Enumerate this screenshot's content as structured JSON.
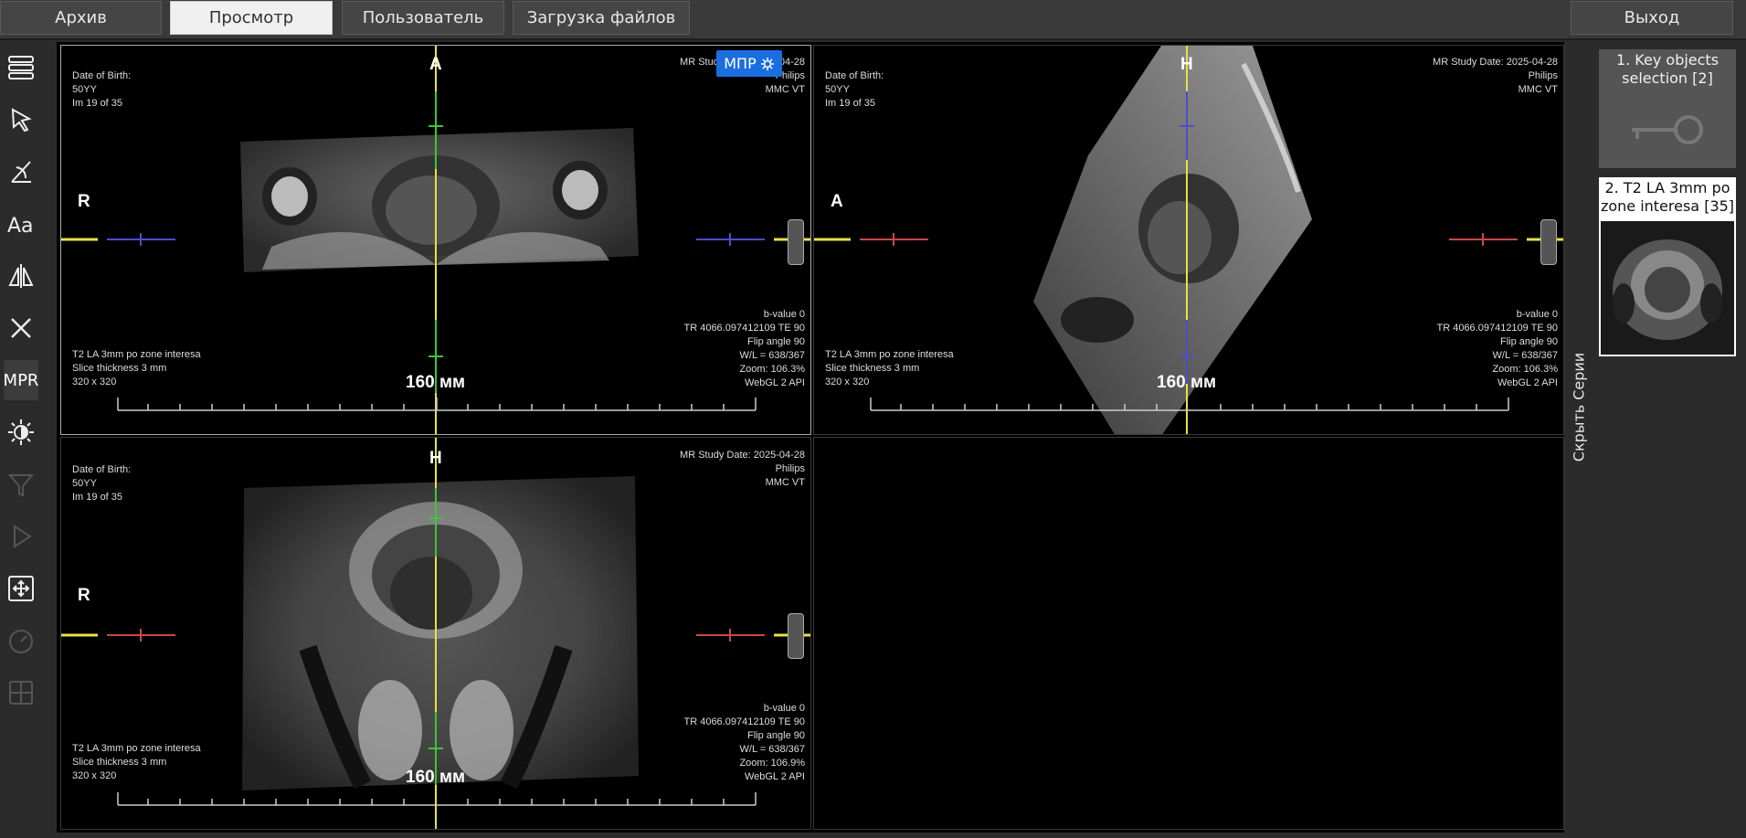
{
  "topbar": {
    "tabs": [
      {
        "label": "Архив"
      },
      {
        "label": "Просмотр"
      },
      {
        "label": "Пользователь"
      },
      {
        "label": "Загрузка файлов"
      }
    ],
    "exit_label": "Выход"
  },
  "toolbar": {
    "mpr_label": "MPR"
  },
  "mpr_badge": {
    "label": "МПР"
  },
  "viewports": [
    {
      "top_left": [
        "Date of Birth:",
        "50YY",
        "Im 19 of 35"
      ],
      "top_right": [
        "MR Study Date: 2025-04-28",
        "Philips",
        "MMC VT"
      ],
      "orient_top": "A",
      "orient_left": "R",
      "bottom_left": [
        "T2 LA 3mm po zone interesa",
        "Slice thickness 3 mm",
        "320 x 320"
      ],
      "bottom_right": [
        "b-value 0",
        "TR 4066.097412109 TE 90",
        "Flip angle 90",
        "W/L = 638/367",
        "Zoom: 106.3%",
        "WebGL 2 API"
      ],
      "scale": "160 мм"
    },
    {
      "top_left": [
        "Date of Birth:",
        "50YY",
        "Im 19 of 35"
      ],
      "top_right": [
        "MR Study Date: 2025-04-28",
        "Philips",
        "MMC VT"
      ],
      "orient_top": "H",
      "orient_left": "A",
      "bottom_left": [
        "T2 LA 3mm po zone interesa",
        "Slice thickness 3 mm",
        "320 x 320"
      ],
      "bottom_right": [
        "b-value 0",
        "TR 4066.097412109 TE 90",
        "Flip angle 90",
        "W/L = 638/367",
        "Zoom: 106.3%",
        "WebGL 2 API"
      ],
      "scale": "160 мм"
    },
    {
      "top_left": [
        "Date of Birth:",
        "50YY",
        "Im 19 of 35"
      ],
      "top_right": [
        "MR Study Date: 2025-04-28",
        "Philips",
        "MMC VT"
      ],
      "orient_top": "H",
      "orient_left": "R",
      "bottom_left": [
        "T2 LA 3mm po zone interesa",
        "Slice thickness 3 mm",
        "320 x 320"
      ],
      "bottom_right": [
        "b-value 0",
        "TR 4066.097412109 TE 90",
        "Flip angle 90",
        "W/L = 638/367",
        "Zoom: 106.9%",
        "WebGL 2 API"
      ],
      "scale": "160 мм"
    }
  ],
  "hide_series_label": "Скрыть Серии",
  "series": [
    {
      "title": "1. Key objects selection [2]"
    },
    {
      "title": "2. T2 LA 3mm po zone interesa [35]"
    }
  ],
  "colors": {
    "yellow_line": "#e8e04a",
    "green_line": "#3ec43e",
    "blue_line": "#4c4ccf",
    "red_line": "#c84848",
    "active_badge": "#1a6ee0"
  }
}
